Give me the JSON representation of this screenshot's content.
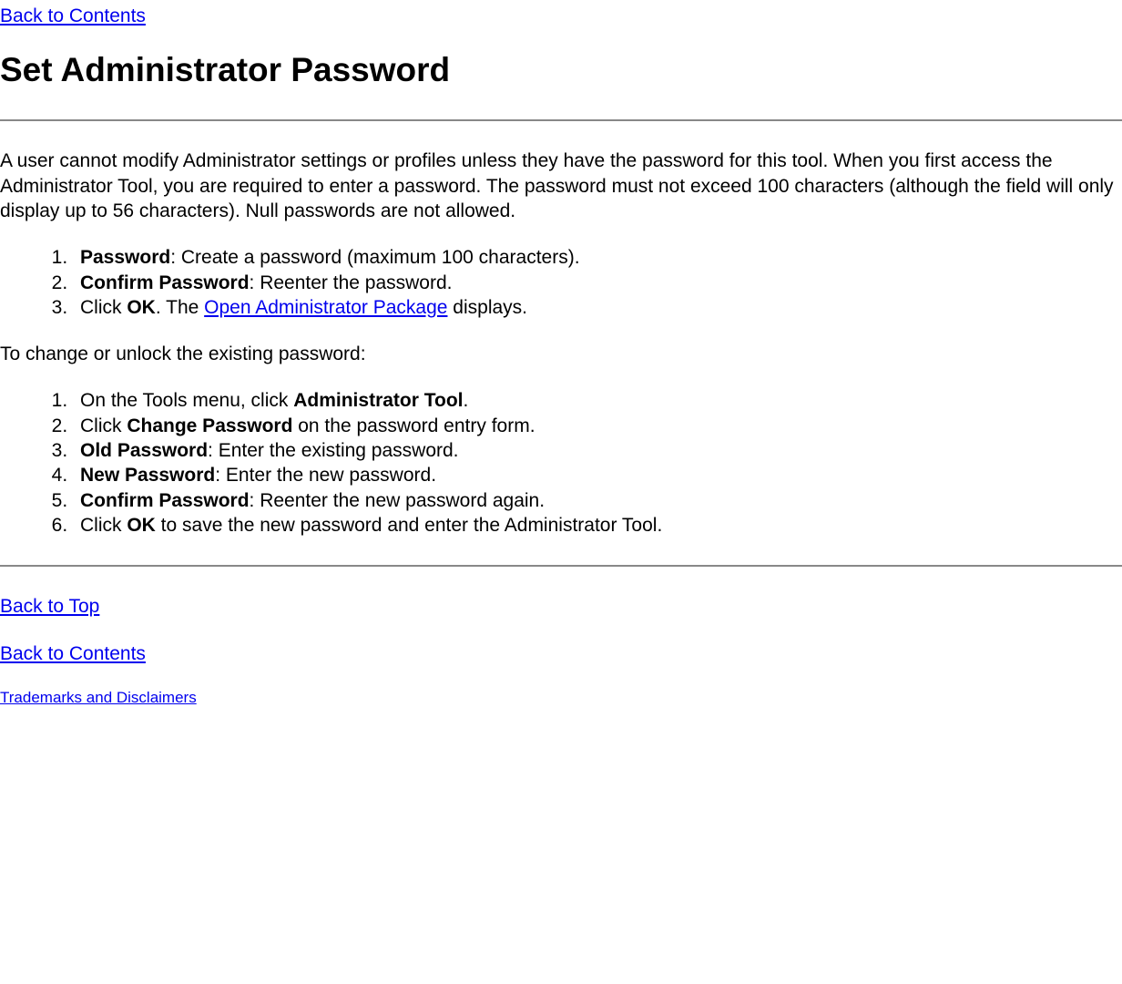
{
  "nav": {
    "back_to_contents": "Back to Contents",
    "back_to_top": "Back to Top",
    "trademarks": "Trademarks and Disclaimers"
  },
  "heading": "Set Administrator Password",
  "intro": "A user cannot modify Administrator settings or profiles unless they have the password for this tool. When you first access the Administrator Tool, you are required to enter a password. The password must not exceed 100 characters (although the field will only display up to 56 characters). Null passwords are not allowed.",
  "list1": {
    "item1_bold": "Password",
    "item1_rest": ": Create a password (maximum 100 characters).",
    "item2_bold": "Confirm Password",
    "item2_rest": ": Reenter the password.",
    "item3_pre": "Click ",
    "item3_bold": "OK",
    "item3_mid": ". The ",
    "item3_link": "Open Administrator Package",
    "item3_end": " displays."
  },
  "subhead": "To change or unlock the existing password:",
  "list2": {
    "item1_pre": "On the Tools menu, click ",
    "item1_bold": "Administrator Tool",
    "item1_end": ".",
    "item2_pre": "Click ",
    "item2_bold": "Change Password",
    "item2_end": " on the password entry form.",
    "item3_bold": "Old Password",
    "item3_rest": ": Enter the existing password.",
    "item4_bold": "New Password",
    "item4_rest": ": Enter the new password.",
    "item5_bold": "Confirm Password",
    "item5_rest": ": Reenter the new password again.",
    "item6_pre": "Click ",
    "item6_bold": "OK",
    "item6_end": " to save the new password and enter the Administrator Tool."
  }
}
